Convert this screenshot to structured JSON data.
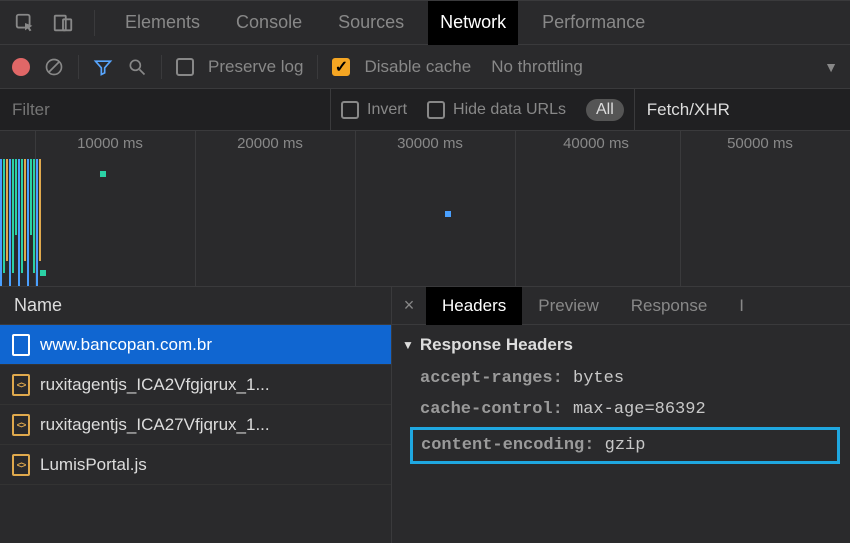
{
  "tabs": {
    "elements": "Elements",
    "console": "Console",
    "sources": "Sources",
    "network": "Network",
    "performance": "Performance"
  },
  "toolbar": {
    "preserve_log": "Preserve log",
    "disable_cache": "Disable cache",
    "throttling": "No throttling"
  },
  "filterbar": {
    "placeholder": "Filter",
    "invert": "Invert",
    "hide_data_urls": "Hide data URLs",
    "all": "All",
    "fetch_xhr": "Fetch/XHR"
  },
  "timeline": {
    "ticks": [
      "10000 ms",
      "20000 ms",
      "30000 ms",
      "40000 ms",
      "50000 ms"
    ]
  },
  "requests": {
    "column_header": "Name",
    "items": [
      {
        "name": "www.bancopan.com.br",
        "type": "doc",
        "selected": true
      },
      {
        "name": "ruxitagentjs_ICA2Vfgjqrux_1...",
        "type": "js",
        "selected": false
      },
      {
        "name": "ruxitagentjs_ICA27Vfjqrux_1...",
        "type": "js",
        "selected": false
      },
      {
        "name": "LumisPortal.js",
        "type": "js",
        "selected": false
      }
    ]
  },
  "details": {
    "tabs": {
      "headers": "Headers",
      "preview": "Preview",
      "response": "Response",
      "initiator": "I"
    },
    "section_title": "Response Headers",
    "headers": [
      {
        "k": "accept-ranges:",
        "v": "bytes",
        "hl": false
      },
      {
        "k": "cache-control:",
        "v": "max-age=86392",
        "hl": false
      },
      {
        "k": "content-encoding:",
        "v": "gzip",
        "hl": true
      }
    ]
  }
}
